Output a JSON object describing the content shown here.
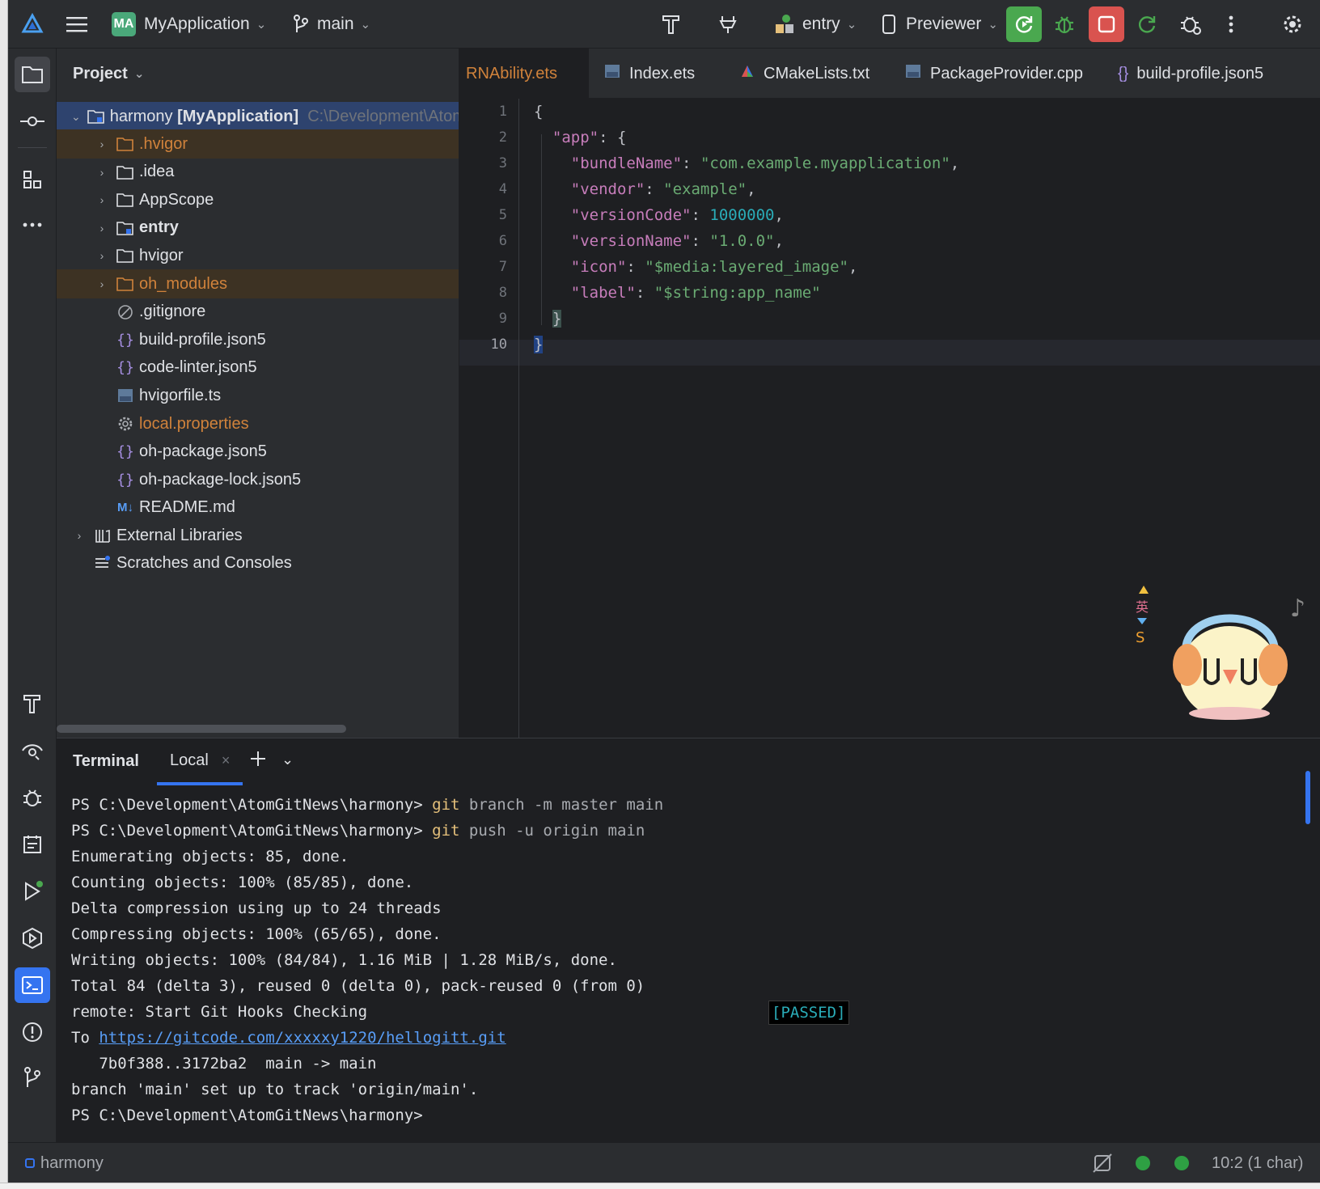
{
  "toolbar": {
    "project_badge": "MA",
    "project_name": "MyApplication",
    "branch": "main",
    "run_config": "entry",
    "device": "Previewer"
  },
  "project_panel": {
    "title": "Project",
    "root": {
      "name": "harmony",
      "module": "[MyApplication]",
      "path": "C:\\Development\\Atom"
    },
    "items": [
      {
        "label": ".hvigor",
        "type": "folder",
        "excluded": true,
        "expandable": true
      },
      {
        "label": ".idea",
        "type": "folder",
        "excluded": false,
        "expandable": true
      },
      {
        "label": "AppScope",
        "type": "folder",
        "excluded": false,
        "expandable": true
      },
      {
        "label": "entry",
        "type": "module",
        "excluded": false,
        "expandable": true,
        "bold": true
      },
      {
        "label": "hvigor",
        "type": "folder",
        "excluded": false,
        "expandable": true
      },
      {
        "label": "oh_modules",
        "type": "folder",
        "excluded": true,
        "expandable": true
      },
      {
        "label": ".gitignore",
        "type": "ignore",
        "excluded": false,
        "expandable": false
      },
      {
        "label": "build-profile.json5",
        "type": "json",
        "excluded": false,
        "expandable": false
      },
      {
        "label": "code-linter.json5",
        "type": "json",
        "excluded": false,
        "expandable": false
      },
      {
        "label": "hvigorfile.ts",
        "type": "ts",
        "excluded": false,
        "expandable": false
      },
      {
        "label": "local.properties",
        "type": "settings",
        "excluded": false,
        "expandable": false,
        "orange": true
      },
      {
        "label": "oh-package.json5",
        "type": "json",
        "excluded": false,
        "expandable": false
      },
      {
        "label": "oh-package-lock.json5",
        "type": "json",
        "excluded": false,
        "expandable": false
      },
      {
        "label": "README.md",
        "type": "md",
        "excluded": false,
        "expandable": false
      }
    ],
    "external_libraries": "External Libraries",
    "scratches": "Scratches and Consoles"
  },
  "editor": {
    "tabs": [
      {
        "label": "RNAbility.ets",
        "icon": "ets-file-icon",
        "active": true
      },
      {
        "label": "Index.ets",
        "icon": "ets-file-icon",
        "active": false
      },
      {
        "label": "CMakeLists.txt",
        "icon": "cmake-icon",
        "active": false
      },
      {
        "label": "PackageProvider.cpp",
        "icon": "cpp-file-icon",
        "active": false
      },
      {
        "label": "build-profile.json5",
        "icon": "json-file-icon",
        "active": false
      }
    ],
    "line_numbers": [
      "1",
      "2",
      "3",
      "4",
      "5",
      "6",
      "7",
      "8",
      "9",
      "10"
    ],
    "current_line": 10,
    "code": {
      "bundleName_key": "\"bundleName\"",
      "bundleName_val": "\"com.example.myapplication\"",
      "vendor_key": "\"vendor\"",
      "vendor_val": "\"example\"",
      "versionCode_key": "\"versionCode\"",
      "versionCode_val": "1000000",
      "versionName_key": "\"versionName\"",
      "versionName_val": "\"1.0.0\"",
      "icon_key": "\"icon\"",
      "icon_val": "\"$media:layered_image\"",
      "label_key": "\"label\"",
      "label_val": "\"$string:app_name\"",
      "app_key": "\"app\""
    }
  },
  "terminal": {
    "title": "Terminal",
    "tab": "Local",
    "prompt": "PS C:\\Development\\AtomGitNews\\harmony>",
    "cmd1_git": "git",
    "cmd1_args": "branch -m master main",
    "cmd2_git": "git",
    "cmd2_args": "push -u origin main",
    "out": [
      "Enumerating objects: 85, done.",
      "Counting objects: 100% (85/85), done.",
      "Delta compression using up to 24 threads",
      "Compressing objects: 100% (65/65), done.",
      "Writing objects: 100% (84/84), 1.16 MiB | 1.28 MiB/s, done.",
      "Total 84 (delta 3), reused 0 (delta 0), pack-reused 0 (from 0)",
      "remote: Start Git Hooks Checking"
    ],
    "passed": "[PASSED]",
    "to_prefix": "To",
    "url": "https://gitcode.com/xxxxxy1220/hellogitt.git",
    "ref_update": "   7b0f388..3172ba2  main -> main",
    "tracking": "branch 'main' set up to track 'origin/main'."
  },
  "status_bar": {
    "project": "harmony",
    "position": "10:2 (1 char)"
  },
  "sticker": {
    "text": "英"
  },
  "colors": {
    "accent": "#3574f0",
    "run_green": "#4aa84f",
    "stop_red": "#d9534f",
    "excluded_orange": "#d0823b"
  }
}
